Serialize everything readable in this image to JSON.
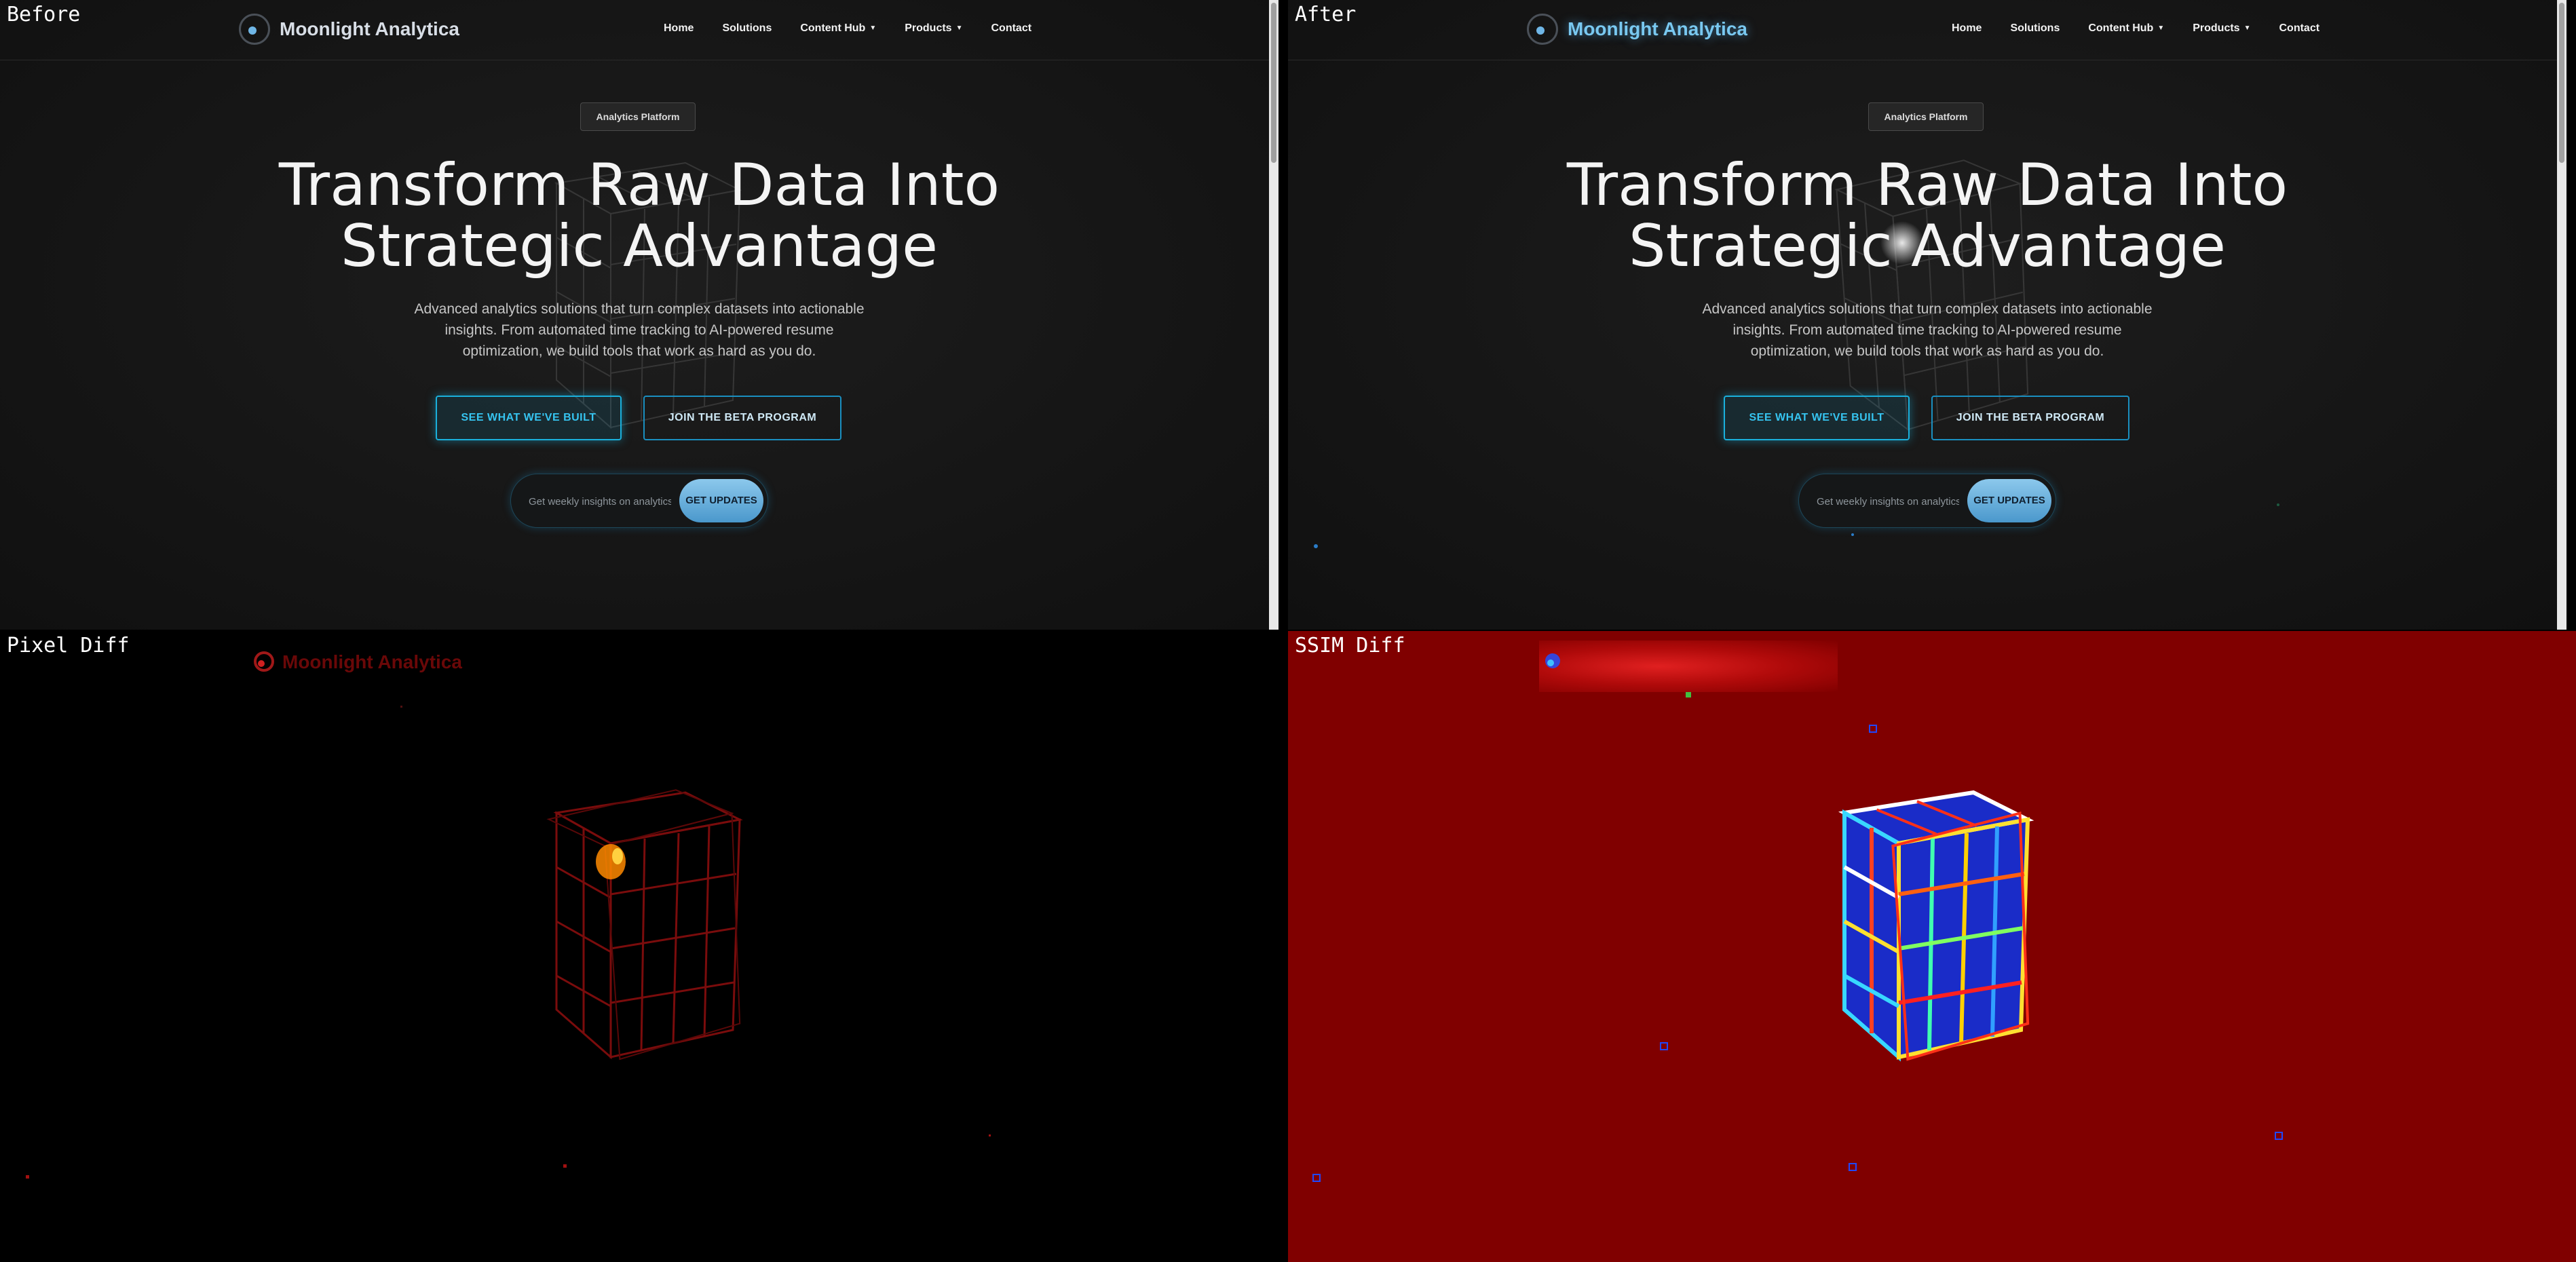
{
  "panels": {
    "before_label": "Before",
    "after_label": "After",
    "pixel_label": "Pixel Diff",
    "ssim_label": "SSIM Diff"
  },
  "site": {
    "brand": "Moonlight Analytica",
    "nav": [
      {
        "label": "Home",
        "dropdown": false
      },
      {
        "label": "Solutions",
        "dropdown": false
      },
      {
        "label": "Content Hub",
        "dropdown": true
      },
      {
        "label": "Products",
        "dropdown": true
      },
      {
        "label": "Contact",
        "dropdown": false
      }
    ],
    "badge": "Analytics Platform",
    "title_line1": "Transform Raw Data Into",
    "title_line2": "Strategic Advantage",
    "subtitle": "Advanced analytics solutions that turn complex datasets into actionable insights. From automated time tracking to AI-powered resume optimization, we build tools that work as hard as you do.",
    "cta_primary": "SEE WHAT WE'VE BUILT",
    "cta_secondary": "JOIN THE BETA PROGRAM",
    "newsletter_placeholder": "Get weekly insights on analytics",
    "newsletter_button": "GET UPDATES"
  },
  "colors": {
    "accent": "#1ab0dc",
    "brand_after": "#79c8f0",
    "background": "#161616",
    "ssim_background": "#800000"
  }
}
